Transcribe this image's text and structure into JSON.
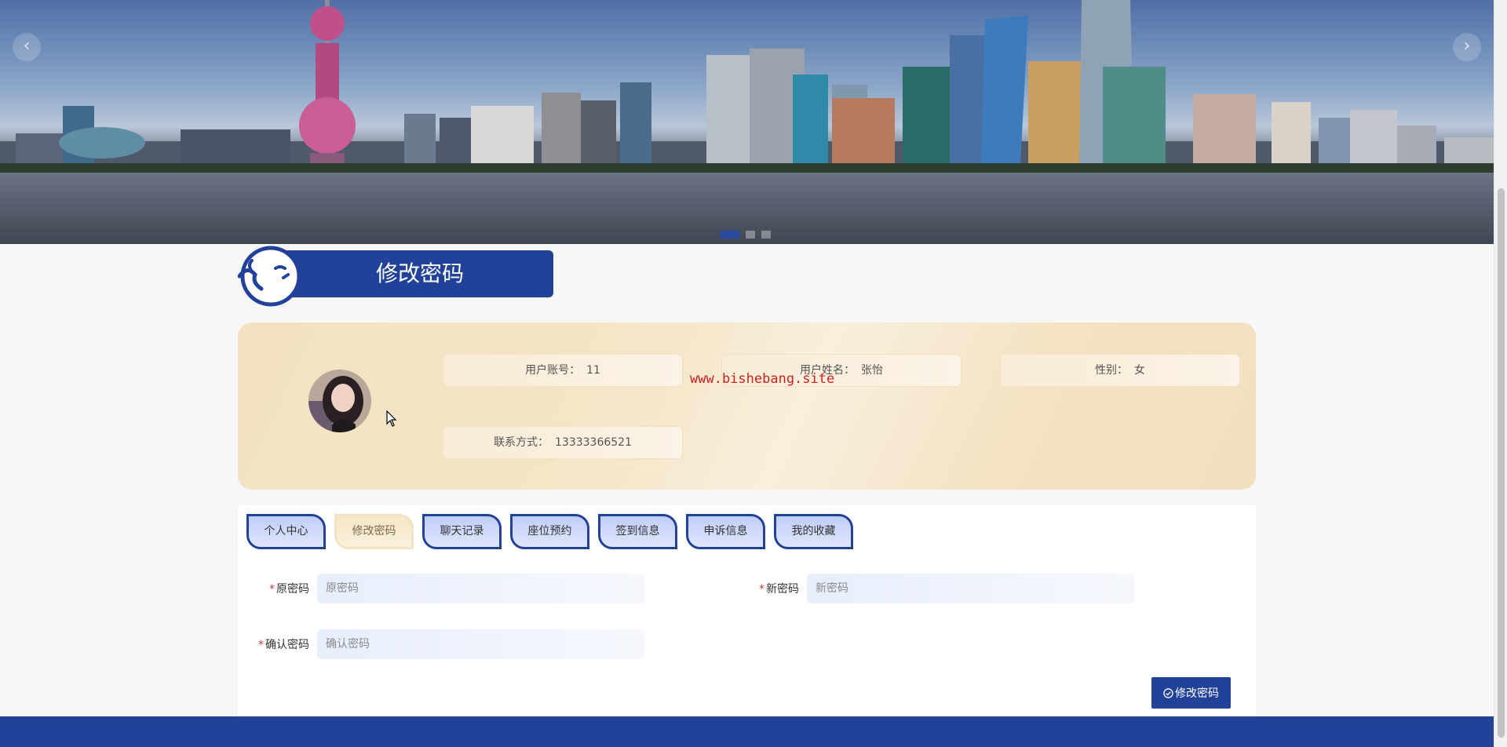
{
  "banner": {
    "prev_arrow": "‹",
    "next_arrow": "›",
    "slide_count": 3,
    "active_slide": 1
  },
  "page_title": "修改密码",
  "profile": {
    "account_label": "用户账号：",
    "account_value": "11",
    "name_label": "用户姓名：",
    "name_value": "张怡",
    "gender_label": "性别：",
    "gender_value": "女",
    "phone_label": "联系方式：",
    "phone_value": "13333366521",
    "watermark": "www.bishebang.site"
  },
  "tabs": [
    {
      "label": "个人中心",
      "active": false
    },
    {
      "label": "修改密码",
      "active": true
    },
    {
      "label": "聊天记录",
      "active": false
    },
    {
      "label": "座位预约",
      "active": false
    },
    {
      "label": "签到信息",
      "active": false
    },
    {
      "label": "申诉信息",
      "active": false
    },
    {
      "label": "我的收藏",
      "active": false
    }
  ],
  "form": {
    "required_mark": "*",
    "old_password_label": "原密码",
    "old_password_placeholder": "原密码",
    "new_password_label": "新密码",
    "new_password_placeholder": "新密码",
    "confirm_password_label": "确认密码",
    "confirm_password_placeholder": "确认密码",
    "submit_label": "修改密码"
  },
  "colors": {
    "primary": "#22429a",
    "card_bg": "#f2e2c2",
    "required": "#e23b3b",
    "watermark": "#cc2020"
  }
}
